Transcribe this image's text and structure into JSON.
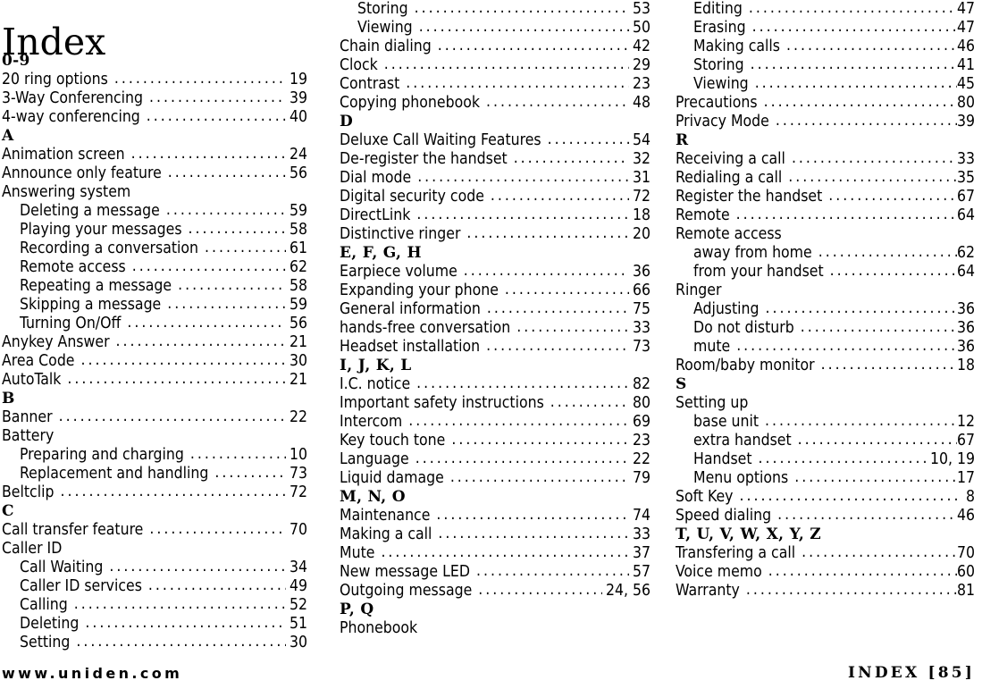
{
  "title": "Index",
  "footer": {
    "left": "www.uniden.com",
    "right": "INDEX  [85]"
  },
  "columns": [
    {
      "id": "column-1",
      "blocks": [
        {
          "type": "section",
          "letter": "0-9"
        },
        {
          "type": "entry",
          "label": "20 ring options",
          "page": "19",
          "sub": false
        },
        {
          "type": "entry",
          "label": "3-Way Conferencing",
          "page": "39",
          "sub": false
        },
        {
          "type": "entry",
          "label": "4-way conferencing",
          "page": "40",
          "sub": false
        },
        {
          "type": "section",
          "letter": "A"
        },
        {
          "type": "entry",
          "label": "Animation screen",
          "page": "24",
          "sub": false
        },
        {
          "type": "entry",
          "label": "Announce only feature",
          "page": "56",
          "sub": false
        },
        {
          "type": "entry",
          "label": "Answering system",
          "page": "",
          "sub": false
        },
        {
          "type": "entry",
          "label": "Deleting a message",
          "page": "59",
          "sub": true
        },
        {
          "type": "entry",
          "label": "Playing your messages",
          "page": "58",
          "sub": true
        },
        {
          "type": "entry",
          "label": "Recording a conversation",
          "page": "61",
          "sub": true
        },
        {
          "type": "entry",
          "label": "Remote access",
          "page": "62",
          "sub": true
        },
        {
          "type": "entry",
          "label": "Repeating a message",
          "page": "58",
          "sub": true
        },
        {
          "type": "entry",
          "label": "Skipping a message",
          "page": "59",
          "sub": true
        },
        {
          "type": "entry",
          "label": "Turning On/Off",
          "page": "56",
          "sub": true
        },
        {
          "type": "entry",
          "label": "Anykey Answer",
          "page": "21",
          "sub": false
        },
        {
          "type": "entry",
          "label": "Area Code",
          "page": "30",
          "sub": false
        },
        {
          "type": "entry",
          "label": "AutoTalk",
          "page": "21",
          "sub": false
        },
        {
          "type": "section",
          "letter": "B"
        },
        {
          "type": "entry",
          "label": "Banner",
          "page": "22",
          "sub": false
        },
        {
          "type": "entry",
          "label": "Battery",
          "page": "",
          "sub": false
        },
        {
          "type": "entry",
          "label": "Preparing and charging",
          "page": "10",
          "sub": true
        },
        {
          "type": "entry",
          "label": "Replacement and handling",
          "page": "73",
          "sub": true
        },
        {
          "type": "entry",
          "label": "Beltclip",
          "page": "72",
          "sub": false
        },
        {
          "type": "section",
          "letter": "C"
        },
        {
          "type": "entry",
          "label": "Call transfer feature",
          "page": "70",
          "sub": false
        },
        {
          "type": "entry",
          "label": "Caller ID",
          "page": "",
          "sub": false
        },
        {
          "type": "entry",
          "label": "Call Waiting",
          "page": "34",
          "sub": true
        },
        {
          "type": "entry",
          "label": "Caller ID services",
          "page": "49",
          "sub": true
        },
        {
          "type": "entry",
          "label": "Calling",
          "page": "52",
          "sub": true
        },
        {
          "type": "entry",
          "label": "Deleting",
          "page": "51",
          "sub": true
        },
        {
          "type": "entry",
          "label": "Setting",
          "page": "30",
          "sub": true
        }
      ]
    },
    {
      "id": "column-2",
      "blocks": [
        {
          "type": "entry",
          "label": "Storing",
          "page": "53",
          "sub": true
        },
        {
          "type": "entry",
          "label": "Viewing",
          "page": "50",
          "sub": true
        },
        {
          "type": "entry",
          "label": "Chain dialing",
          "page": "42",
          "sub": false
        },
        {
          "type": "entry",
          "label": "Clock",
          "page": "29",
          "sub": false
        },
        {
          "type": "entry",
          "label": "Contrast",
          "page": "23",
          "sub": false
        },
        {
          "type": "entry",
          "label": "Copying phonebook",
          "page": "48",
          "sub": false
        },
        {
          "type": "section",
          "letter": "D"
        },
        {
          "type": "entry",
          "label": "Deluxe Call Waiting Features",
          "page": "54",
          "sub": false
        },
        {
          "type": "entry",
          "label": "De-register the handset",
          "page": "32",
          "sub": false
        },
        {
          "type": "entry",
          "label": "Dial mode",
          "page": "31",
          "sub": false
        },
        {
          "type": "entry",
          "label": "Digital security code",
          "page": "72",
          "sub": false
        },
        {
          "type": "entry",
          "label": "DirectLink",
          "page": "18",
          "sub": false
        },
        {
          "type": "entry",
          "label": "Distinctive ringer",
          "page": "20",
          "sub": false
        },
        {
          "type": "section",
          "letter": "E, F, G, H"
        },
        {
          "type": "entry",
          "label": "Earpiece volume",
          "page": "36",
          "sub": false
        },
        {
          "type": "entry",
          "label": "Expanding your phone",
          "page": "66",
          "sub": false
        },
        {
          "type": "entry",
          "label": "General information",
          "page": "75",
          "sub": false
        },
        {
          "type": "entry",
          "label": "hands-free conversation",
          "page": "33",
          "sub": false
        },
        {
          "type": "entry",
          "label": "Headset installation",
          "page": "73",
          "sub": false
        },
        {
          "type": "section",
          "letter": "I, J, K, L"
        },
        {
          "type": "entry",
          "label": "I.C. notice",
          "page": "82",
          "sub": false
        },
        {
          "type": "entry",
          "label": "Important safety instructions",
          "page": "80",
          "sub": false
        },
        {
          "type": "entry",
          "label": "Intercom",
          "page": "69",
          "sub": false
        },
        {
          "type": "entry",
          "label": "Key touch tone",
          "page": "23",
          "sub": false
        },
        {
          "type": "entry",
          "label": "Language",
          "page": "22",
          "sub": false
        },
        {
          "type": "entry",
          "label": "Liquid damage",
          "page": "79",
          "sub": false
        },
        {
          "type": "section",
          "letter": "M, N, O"
        },
        {
          "type": "entry",
          "label": "Maintenance",
          "page": "74",
          "sub": false
        },
        {
          "type": "entry",
          "label": "Making a call",
          "page": "33",
          "sub": false
        },
        {
          "type": "entry",
          "label": "Mute",
          "page": "37",
          "sub": false
        },
        {
          "type": "entry",
          "label": "New message LED",
          "page": "57",
          "sub": false
        },
        {
          "type": "entry",
          "label": "Outgoing message",
          "page": "24, 56",
          "sub": false
        },
        {
          "type": "section",
          "letter": "P, Q"
        },
        {
          "type": "entry",
          "label": "Phonebook",
          "page": "",
          "sub": false
        }
      ]
    },
    {
      "id": "column-3",
      "blocks": [
        {
          "type": "entry",
          "label": "Editing",
          "page": "47",
          "sub": true
        },
        {
          "type": "entry",
          "label": "Erasing",
          "page": "47",
          "sub": true
        },
        {
          "type": "entry",
          "label": "Making calls",
          "page": "46",
          "sub": true
        },
        {
          "type": "entry",
          "label": "Storing",
          "page": "41",
          "sub": true
        },
        {
          "type": "entry",
          "label": "Viewing",
          "page": "45",
          "sub": true
        },
        {
          "type": "entry",
          "label": "Precautions",
          "page": "80",
          "sub": false
        },
        {
          "type": "entry",
          "label": "Privacy Mode",
          "page": "39",
          "sub": false
        },
        {
          "type": "section",
          "letter": "R"
        },
        {
          "type": "entry",
          "label": "Receiving a call",
          "page": "33",
          "sub": false
        },
        {
          "type": "entry",
          "label": "Redialing a call",
          "page": "35",
          "sub": false
        },
        {
          "type": "entry",
          "label": "Register the handset",
          "page": "67",
          "sub": false
        },
        {
          "type": "entry",
          "label": "Remote",
          "page": "64",
          "sub": false
        },
        {
          "type": "entry",
          "label": "Remote access",
          "page": "",
          "sub": false
        },
        {
          "type": "entry",
          "label": "away from home",
          "page": "62",
          "sub": true
        },
        {
          "type": "entry",
          "label": "from your handset",
          "page": "64",
          "sub": true
        },
        {
          "type": "entry",
          "label": "Ringer",
          "page": "",
          "sub": false
        },
        {
          "type": "entry",
          "label": "Adjusting",
          "page": "36",
          "sub": true
        },
        {
          "type": "entry",
          "label": "Do not disturb",
          "page": "36",
          "sub": true
        },
        {
          "type": "entry",
          "label": "mute",
          "page": "36",
          "sub": true
        },
        {
          "type": "entry",
          "label": "Room/baby monitor",
          "page": "18",
          "sub": false
        },
        {
          "type": "section",
          "letter": "S"
        },
        {
          "type": "entry",
          "label": "Setting up",
          "page": "",
          "sub": false
        },
        {
          "type": "entry",
          "label": "base unit",
          "page": "12",
          "sub": true
        },
        {
          "type": "entry",
          "label": "extra handset",
          "page": "67",
          "sub": true
        },
        {
          "type": "entry",
          "label": "Handset",
          "page": "10, 19",
          "sub": true
        },
        {
          "type": "entry",
          "label": "Menu options",
          "page": "17",
          "sub": true
        },
        {
          "type": "entry",
          "label": "Soft Key",
          "page": "8",
          "sub": false
        },
        {
          "type": "entry",
          "label": "Speed dialing",
          "page": "46",
          "sub": false
        },
        {
          "type": "section",
          "letter": "T, U, V, W, X, Y, Z"
        },
        {
          "type": "entry",
          "label": "Transfering a call",
          "page": "70",
          "sub": false
        },
        {
          "type": "entry",
          "label": "Voice memo",
          "page": "60",
          "sub": false
        },
        {
          "type": "entry",
          "label": "Warranty",
          "page": "81",
          "sub": false
        }
      ]
    }
  ]
}
